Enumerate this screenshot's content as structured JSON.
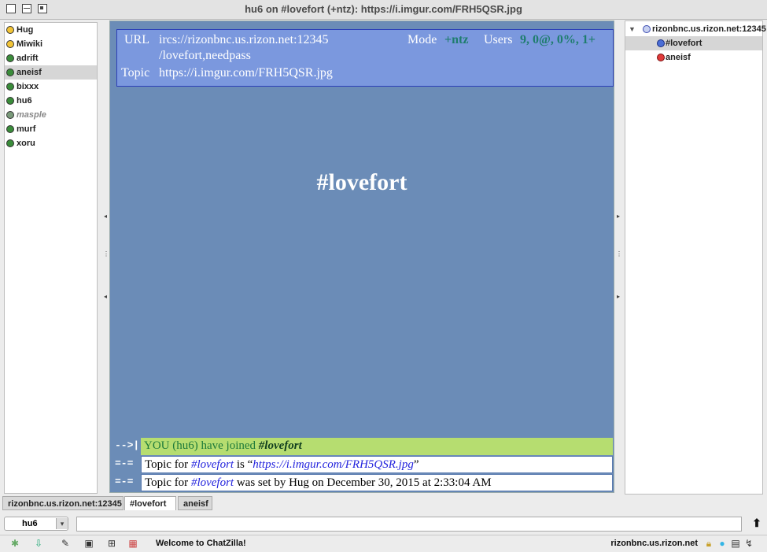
{
  "window": {
    "title": "hu6 on #lovefort (+ntz): https://i.imgur.com/FRH5QSR.jpg"
  },
  "userlist": [
    {
      "name": "Hug",
      "status": "normal"
    },
    {
      "name": "Miwiki",
      "status": "normal"
    },
    {
      "name": "adrift",
      "status": "op"
    },
    {
      "name": "aneisf",
      "status": "op",
      "selected": true
    },
    {
      "name": "bixxx",
      "status": "op"
    },
    {
      "name": "hu6",
      "status": "op"
    },
    {
      "name": "masple",
      "status": "away"
    },
    {
      "name": "murf",
      "status": "op"
    },
    {
      "name": "xoru",
      "status": "op"
    }
  ],
  "header": {
    "url_label": "URL",
    "url_value_line1": "ircs://rizonbnc.us.rizon.net:12345",
    "url_value_line2": "/lovefort,needpass",
    "mode_label": "Mode",
    "mode_value": "+ntz",
    "users_label": "Users",
    "users_value": "9, 0@, 0%, 1+",
    "topic_label": "Topic",
    "topic_value": "https://i.imgur.com/FRH5QSR.jpg"
  },
  "channel_name": "#lovefort",
  "messages": [
    {
      "type": "-->|",
      "kind": "join",
      "text_prefix": "YOU (hu6) have joined ",
      "channel": "#lovefort"
    },
    {
      "type": "=-=",
      "kind": "topic",
      "text_prefix": "Topic for ",
      "channel": "#lovefort",
      "text_mid": " is “",
      "url": "https://i.imgur.com/FRH5QSR.jpg",
      "text_suffix": "”"
    },
    {
      "type": "=-=",
      "kind": "topic",
      "text_prefix": "Topic for ",
      "channel": "#lovefort",
      "text_suffix": " was set by Hug on December 30, 2015 at 2:33:04 AM"
    }
  ],
  "tree": {
    "server": "rizonbnc.us.rizon.net:12345",
    "items": [
      {
        "name": "#lovefort",
        "selected": true
      },
      {
        "name": "aneisf",
        "selected": false
      }
    ]
  },
  "tabs": [
    {
      "label": "rizonbnc.us.rizon.net:12345",
      "active": false
    },
    {
      "label": "#lovefort",
      "active": true
    },
    {
      "label": "aneisf",
      "active": false
    }
  ],
  "input": {
    "nick": "hu6",
    "message": ""
  },
  "status": {
    "message": "Welcome to ChatZilla!",
    "server": "rizonbnc.us.rizon.net"
  },
  "icons": {
    "toolbar": [
      "star-icon",
      "download-icon",
      "pencil-icon",
      "image-icon",
      "puzzle-icon",
      "calendar-icon"
    ],
    "status_right": [
      "lock-icon",
      "speech-bubble-icon",
      "document-icon",
      "connection-icon"
    ]
  },
  "colors": {
    "main_bg": "#6b8cb7",
    "header_bg": "#7b98de",
    "join_bg": "#b6dd70",
    "accent_teal": "#1f7d6e"
  }
}
